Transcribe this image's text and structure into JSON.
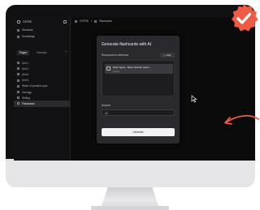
{
  "sidebar": {
    "workspace": "OSTRE",
    "items": [
      {
        "label": "Shortcuts",
        "icon": "grid-icon"
      },
      {
        "label": "Knowledge",
        "icon": "book-icon"
      }
    ],
    "tabs": [
      {
        "label": "Pages"
      },
      {
        "label": "Outlooks"
      }
    ],
    "pages": [
      {
        "label": "Unit 1",
        "active": false
      },
      {
        "label": "Unit 2",
        "active": false
      },
      {
        "label": "Unit 3",
        "active": false
      },
      {
        "label": "Unit 4",
        "active": false
      },
      {
        "label": "Week 10 practice quiz",
        "active": false
      },
      {
        "label": "Geology",
        "active": false
      },
      {
        "label": "Writing",
        "active": false
      },
      {
        "label": "Flashcards",
        "active": true
      }
    ]
  },
  "header": {
    "crumb1": "OSTRE",
    "crumb2": "Flashcards"
  },
  "modal": {
    "title": "Generate flashcards with AI",
    "references_label": "Resources to reference",
    "add_label": "Add",
    "reference_name": "Data Types - Base Teacher (learn...",
    "reference_sub": "Folder",
    "amount_label": "Amount",
    "amount_value": "10",
    "generate_label": "Generate"
  },
  "colors": {
    "badge": "#ef5a44",
    "arrow": "#ef5a44",
    "screen_bg": "#0b0b0c",
    "modal_bg": "#2a2a2e"
  }
}
